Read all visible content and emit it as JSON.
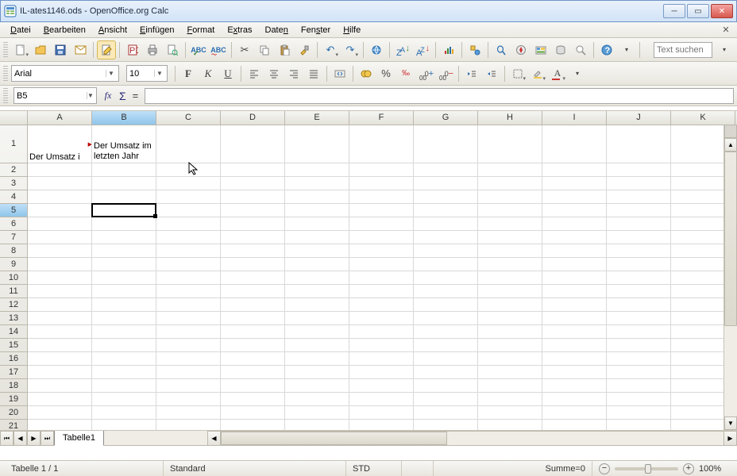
{
  "window": {
    "title": "IL-ates1146.ods - OpenOffice.org Calc"
  },
  "menu": {
    "items": [
      "Datei",
      "Bearbeiten",
      "Ansicht",
      "Einfügen",
      "Format",
      "Extras",
      "Daten",
      "Fenster",
      "Hilfe"
    ]
  },
  "search": {
    "placeholder": "Text suchen"
  },
  "font": {
    "name": "Arial",
    "size": "10"
  },
  "namebox": {
    "value": "B5"
  },
  "formula": {
    "value": ""
  },
  "columns": [
    "A",
    "B",
    "C",
    "D",
    "E",
    "F",
    "G",
    "H",
    "I",
    "J",
    "K"
  ],
  "selected_column": "B",
  "rows": [
    1,
    2,
    3,
    4,
    5,
    6,
    7,
    8,
    9,
    10,
    11,
    12,
    13,
    14,
    15,
    16,
    17,
    18,
    19,
    20,
    21
  ],
  "selected_row": 5,
  "cells": {
    "A1": "Der Umsatz i",
    "B1": "Der Umsatz im letzten Jahr"
  },
  "active_cell": "B5",
  "tabs": {
    "active": "Tabelle1"
  },
  "status": {
    "sheet": "Tabelle 1 / 1",
    "style": "Standard",
    "mode": "STD",
    "sum": "Summe=0",
    "zoom": "100%"
  },
  "icons": {
    "bold": "F",
    "italic": "K",
    "underline": "U",
    "align_left": "≡",
    "align_center": "≡",
    "align_right": "≡",
    "align_just": "≡",
    "sigma": "Σ",
    "fx": "fx",
    "eq": "="
  }
}
